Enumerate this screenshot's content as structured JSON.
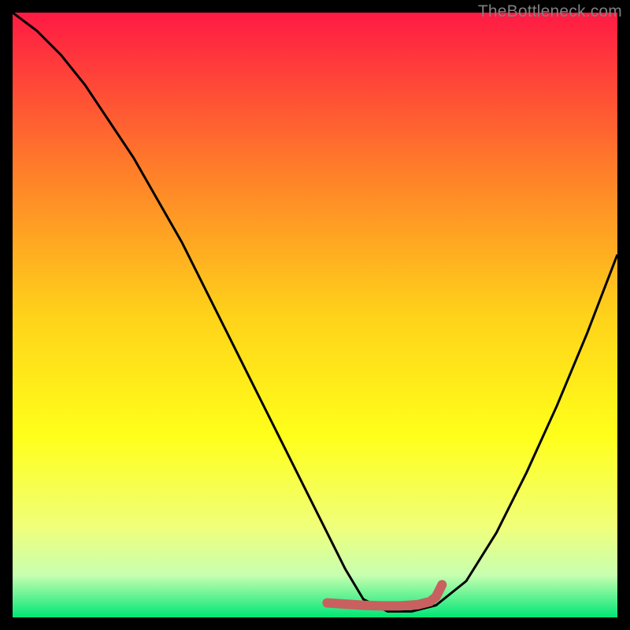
{
  "attribution": "TheBottleneck.com",
  "chart_data": {
    "type": "line",
    "title": "",
    "xlabel": "",
    "ylabel": "",
    "xlim": [
      0,
      100
    ],
    "ylim": [
      0,
      100
    ],
    "background_gradient": {
      "stops": [
        {
          "offset": 0.0,
          "color": "#ff1a44"
        },
        {
          "offset": 0.25,
          "color": "#ff7a2a"
        },
        {
          "offset": 0.5,
          "color": "#ffd21a"
        },
        {
          "offset": 0.7,
          "color": "#ffff1a"
        },
        {
          "offset": 0.85,
          "color": "#f0ff7a"
        },
        {
          "offset": 0.93,
          "color": "#c8ffb0"
        },
        {
          "offset": 1.0,
          "color": "#00e676"
        }
      ]
    },
    "series": [
      {
        "name": "bottleneck-curve",
        "color": "#000000",
        "x": [
          0,
          4,
          8,
          12,
          16,
          20,
          24,
          28,
          32,
          36,
          40,
          44,
          48,
          52,
          55,
          58,
          62,
          66,
          70,
          75,
          80,
          85,
          90,
          95,
          100
        ],
        "y": [
          100,
          97,
          93,
          88,
          82,
          76,
          69,
          62,
          54,
          46,
          38,
          30,
          22,
          14,
          8,
          3,
          1,
          1,
          2,
          6,
          14,
          24,
          35,
          47,
          60
        ]
      },
      {
        "name": "optimal-band",
        "color": "#c86060",
        "x": [
          52,
          55,
          58,
          61,
          64,
          67,
          69,
          70,
          71
        ],
        "y": [
          2.4,
          2.2,
          2.0,
          1.9,
          1.9,
          2.1,
          2.6,
          3.4,
          5.4
        ]
      }
    ]
  }
}
